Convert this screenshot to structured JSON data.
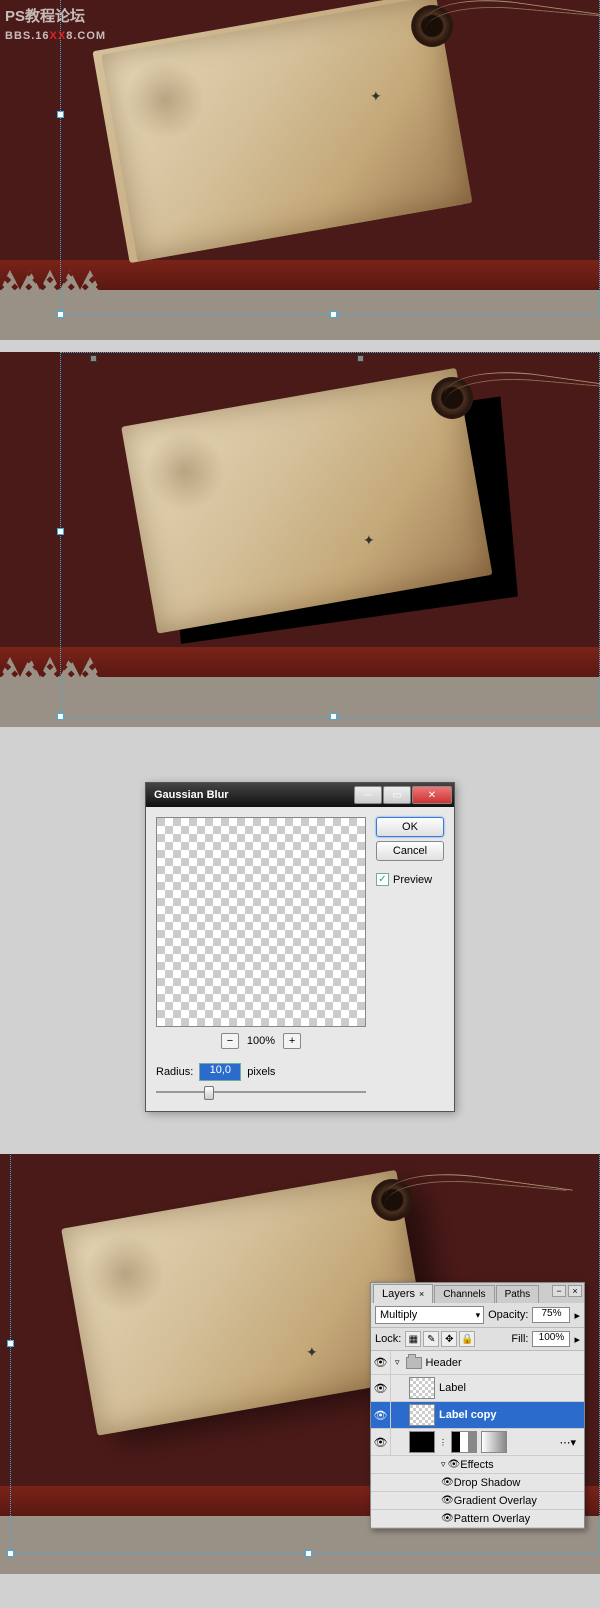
{
  "watermark": {
    "line1": "PS教程论坛",
    "line2_a": "BBS.16",
    "line2_b": "XX",
    "line2_c": "8.COM"
  },
  "dialog": {
    "title": "Gaussian Blur",
    "ok": "OK",
    "cancel": "Cancel",
    "preview": "Preview",
    "zoom": "100%",
    "radius_label": "Radius:",
    "radius_value": "10,0",
    "radius_unit": "pixels"
  },
  "layers": {
    "tabs": [
      "Layers",
      "Channels",
      "Paths"
    ],
    "blend_mode": "Multiply",
    "opacity_label": "Opacity:",
    "opacity_value": "75%",
    "lock_label": "Lock:",
    "fill_label": "Fill:",
    "fill_value": "100%",
    "items": [
      {
        "type": "group",
        "name": "Header"
      },
      {
        "type": "layer",
        "name": "Label"
      },
      {
        "type": "layer",
        "name": "Label copy",
        "selected": true
      },
      {
        "type": "layer-mask",
        "name": ""
      },
      {
        "type": "effects-header",
        "name": "Effects"
      },
      {
        "type": "effect",
        "name": "Drop Shadow"
      },
      {
        "type": "effect",
        "name": "Gradient Overlay"
      },
      {
        "type": "effect",
        "name": "Pattern Overlay"
      }
    ]
  }
}
